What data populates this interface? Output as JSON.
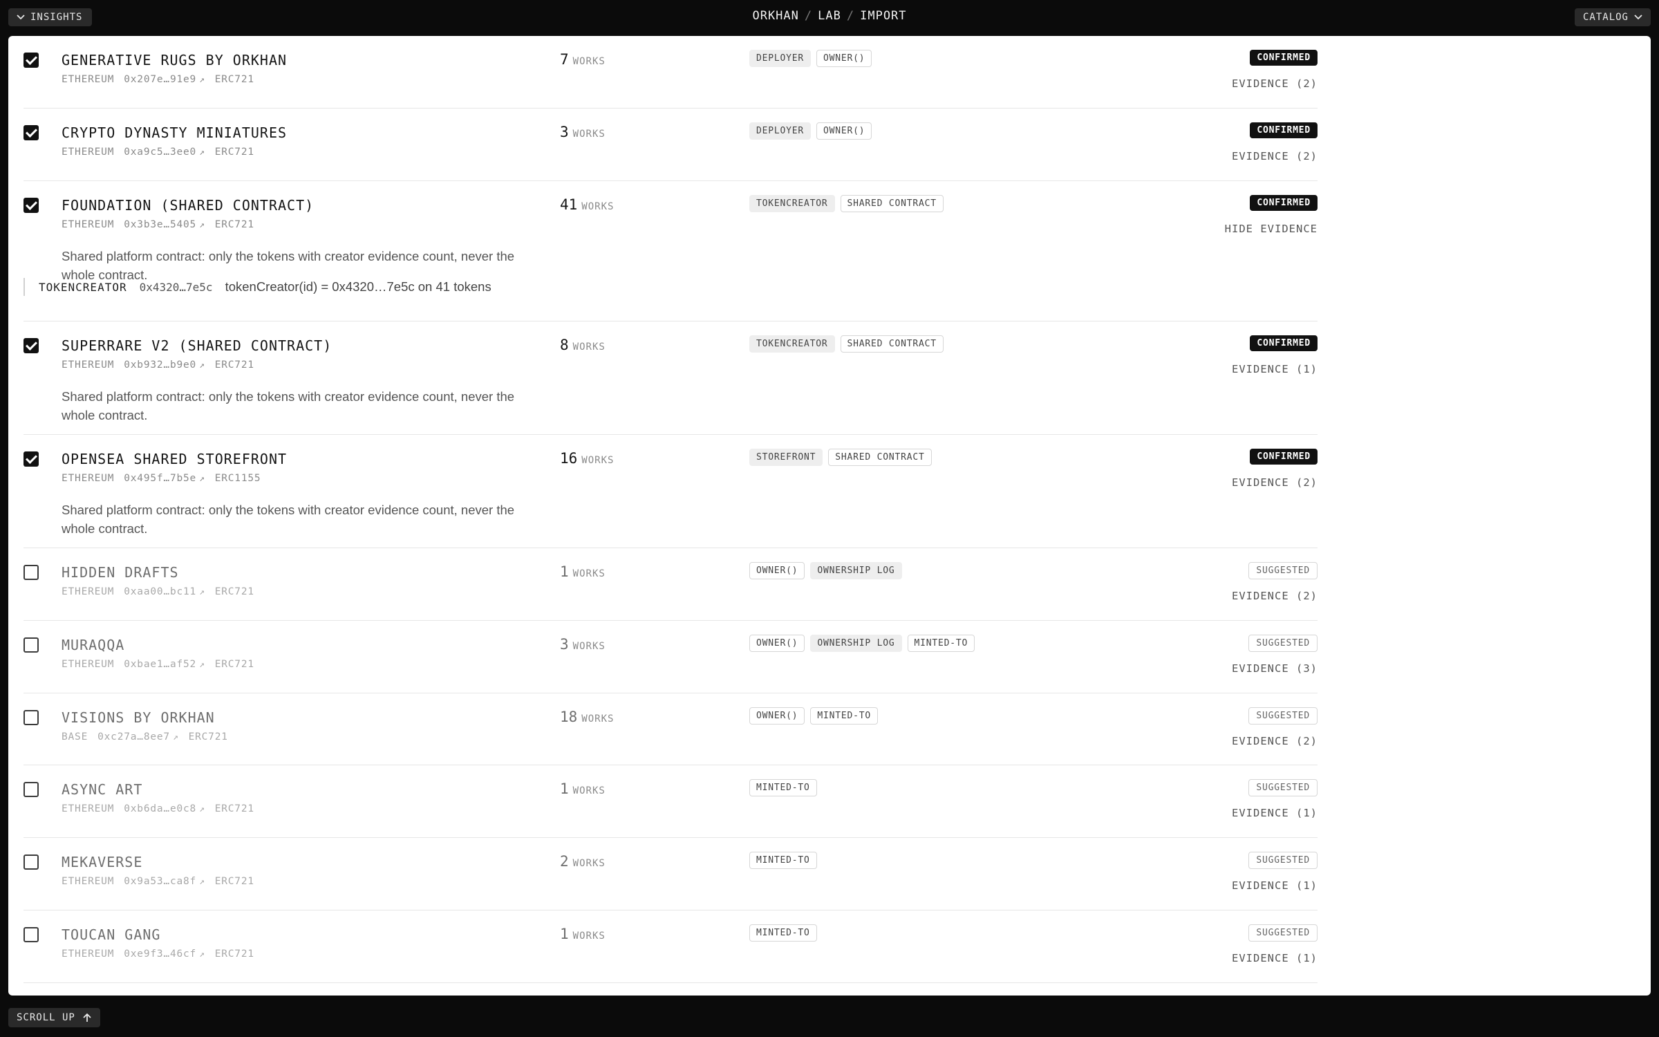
{
  "header": {
    "insights_label": "INSIGHTS",
    "catalog_label": "CATALOG",
    "breadcrumb": [
      "ORKHAN",
      "LAB",
      "IMPORT"
    ],
    "separator": "/"
  },
  "footer": {
    "scroll_up_label": "SCROLL UP"
  },
  "works_label": "WORKS",
  "evidence_detail": {
    "key": "TOKENCREATOR",
    "address": "0x4320…7e5c",
    "text": "tokenCreator(id) = 0x4320…7e5c on 41 tokens"
  },
  "rows": [
    {
      "checked": true,
      "name": "GENERATIVE RUGS BY ORKHAN",
      "chain": "ETHEREUM",
      "address": "0x207e…91e9",
      "standard": "ERC721",
      "count": "7",
      "tags": [
        {
          "text": "DEPLOYER",
          "style": "filled"
        },
        {
          "text": "OWNER()",
          "style": "outline"
        }
      ],
      "status": "CONFIRMED",
      "evidence": "EVIDENCE (2)",
      "description": ""
    },
    {
      "checked": true,
      "name": "CRYPTO DYNASTY MINIATURES",
      "chain": "ETHEREUM",
      "address": "0xa9c5…3ee0",
      "standard": "ERC721",
      "count": "3",
      "tags": [
        {
          "text": "DEPLOYER",
          "style": "filled"
        },
        {
          "text": "OWNER()",
          "style": "outline"
        }
      ],
      "status": "CONFIRMED",
      "evidence": "EVIDENCE (2)",
      "description": ""
    },
    {
      "checked": true,
      "name": "FOUNDATION (SHARED CONTRACT)",
      "chain": "ETHEREUM",
      "address": "0x3b3e…5405",
      "standard": "ERC721",
      "count": "41",
      "tags": [
        {
          "text": "TOKENCREATOR",
          "style": "filled"
        },
        {
          "text": "SHARED CONTRACT",
          "style": "outline"
        }
      ],
      "status": "CONFIRMED",
      "evidence": "HIDE EVIDENCE",
      "description": "Shared platform contract: only the tokens with creator evidence count, never the whole contract."
    },
    {
      "checked": true,
      "name": "SUPERRARE V2 (SHARED CONTRACT)",
      "chain": "ETHEREUM",
      "address": "0xb932…b9e0",
      "standard": "ERC721",
      "count": "8",
      "tags": [
        {
          "text": "TOKENCREATOR",
          "style": "filled"
        },
        {
          "text": "SHARED CONTRACT",
          "style": "outline"
        }
      ],
      "status": "CONFIRMED",
      "evidence": "EVIDENCE (1)",
      "description": "Shared platform contract: only the tokens with creator evidence count, never the whole contract."
    },
    {
      "checked": true,
      "name": "OPENSEA SHARED STOREFRONT",
      "chain": "ETHEREUM",
      "address": "0x495f…7b5e",
      "standard": "ERC1155",
      "count": "16",
      "tags": [
        {
          "text": "STOREFRONT",
          "style": "filled"
        },
        {
          "text": "SHARED CONTRACT",
          "style": "outline"
        }
      ],
      "status": "CONFIRMED",
      "evidence": "EVIDENCE (2)",
      "description": "Shared platform contract: only the tokens with creator evidence count, never the whole contract."
    },
    {
      "checked": false,
      "name": "HIDDEN DRAFTS",
      "chain": "ETHEREUM",
      "address": "0xaa00…bc11",
      "standard": "ERC721",
      "count": "1",
      "tags": [
        {
          "text": "OWNER()",
          "style": "outline"
        },
        {
          "text": "OWNERSHIP LOG",
          "style": "filled"
        }
      ],
      "status": "SUGGESTED",
      "evidence": "EVIDENCE (2)",
      "description": ""
    },
    {
      "checked": false,
      "name": "MURAQQA",
      "chain": "ETHEREUM",
      "address": "0xbae1…af52",
      "standard": "ERC721",
      "count": "3",
      "tags": [
        {
          "text": "OWNER()",
          "style": "outline"
        },
        {
          "text": "OWNERSHIP LOG",
          "style": "filled"
        },
        {
          "text": "MINTED-TO",
          "style": "outline"
        }
      ],
      "status": "SUGGESTED",
      "evidence": "EVIDENCE (3)",
      "description": ""
    },
    {
      "checked": false,
      "name": "VISIONS BY ORKHAN",
      "chain": "BASE",
      "address": "0xc27a…8ee7",
      "standard": "ERC721",
      "count": "18",
      "tags": [
        {
          "text": "OWNER()",
          "style": "outline"
        },
        {
          "text": "MINTED-TO",
          "style": "outline"
        }
      ],
      "status": "SUGGESTED",
      "evidence": "EVIDENCE (2)",
      "description": ""
    },
    {
      "checked": false,
      "name": "ASYNC ART",
      "chain": "ETHEREUM",
      "address": "0xb6da…e0c8",
      "standard": "ERC721",
      "count": "1",
      "tags": [
        {
          "text": "MINTED-TO",
          "style": "outline"
        }
      ],
      "status": "SUGGESTED",
      "evidence": "EVIDENCE (1)",
      "description": ""
    },
    {
      "checked": false,
      "name": "MEKAVERSE",
      "chain": "ETHEREUM",
      "address": "0x9a53…ca8f",
      "standard": "ERC721",
      "count": "2",
      "tags": [
        {
          "text": "MINTED-TO",
          "style": "outline"
        }
      ],
      "status": "SUGGESTED",
      "evidence": "EVIDENCE (1)",
      "description": ""
    },
    {
      "checked": false,
      "name": "TOUCAN GANG",
      "chain": "ETHEREUM",
      "address": "0xe9f3…46cf",
      "standard": "ERC721",
      "count": "1",
      "tags": [
        {
          "text": "MINTED-TO",
          "style": "outline"
        }
      ],
      "status": "SUGGESTED",
      "evidence": "EVIDENCE (1)",
      "description": ""
    }
  ]
}
